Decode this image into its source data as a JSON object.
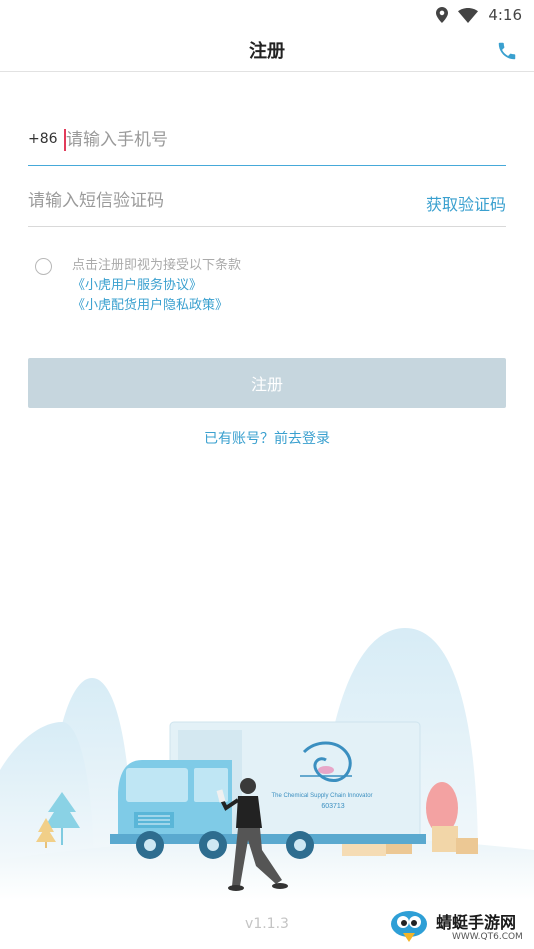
{
  "status_bar": {
    "time": "4:16"
  },
  "app_bar": {
    "title": "注册"
  },
  "phone_field": {
    "prefix": "+86",
    "placeholder": "请输入手机号"
  },
  "code_field": {
    "placeholder": "请输入短信验证码",
    "get_code_label": "获取验证码"
  },
  "agreement": {
    "intro": "点击注册即视为接受以下条款",
    "user_agreement": "《小虎用户服务协议》",
    "privacy_policy": "《小虎配货用户隐私政策》"
  },
  "register_button": {
    "label": "注册"
  },
  "login_link": {
    "label": "已有账号？前去登录"
  },
  "illustration": {
    "truck_logo_text": "The Chemical Supply Chain Innovator",
    "truck_code": "603713"
  },
  "version": "v1.1.3",
  "watermark": {
    "brand": "蜻蜓手游网",
    "url": "WWW.QT6.COM"
  },
  "colors": {
    "accent": "#3aa0cf",
    "button_disabled": "#c6d6de",
    "cursor": "#e23b5a"
  }
}
